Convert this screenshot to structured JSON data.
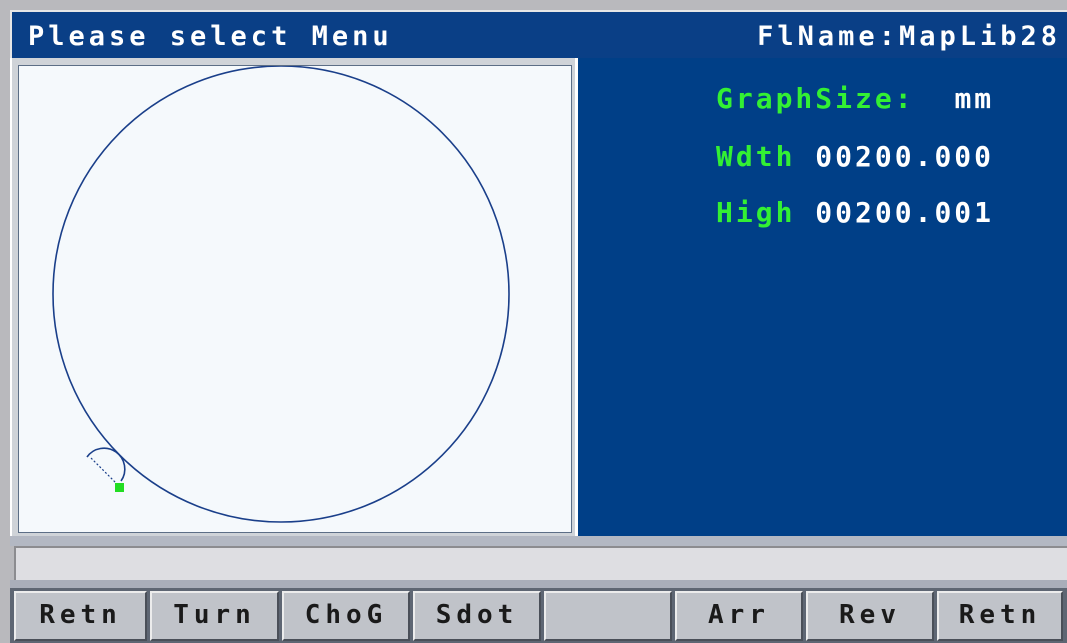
{
  "title_bar": {
    "prompt": "Please select Menu",
    "file_name": "FlName:MapLib28"
  },
  "info": {
    "graph_size_label": "GraphSize:",
    "unit": "mm",
    "width_label": "Wdth",
    "width_value": "00200.000",
    "height_label": "High",
    "height_value": "00200.001"
  },
  "status": {
    "message": ""
  },
  "menu": {
    "buttons": [
      "Retn",
      "Turn",
      "ChoG",
      "Sdot",
      "",
      "Arr",
      "Rev",
      "Retn"
    ]
  },
  "colors": {
    "panel_blue": "#003f87",
    "label_green": "#33f033",
    "graph_line": "#1a3f8a",
    "start_marker": "#22dd22"
  }
}
